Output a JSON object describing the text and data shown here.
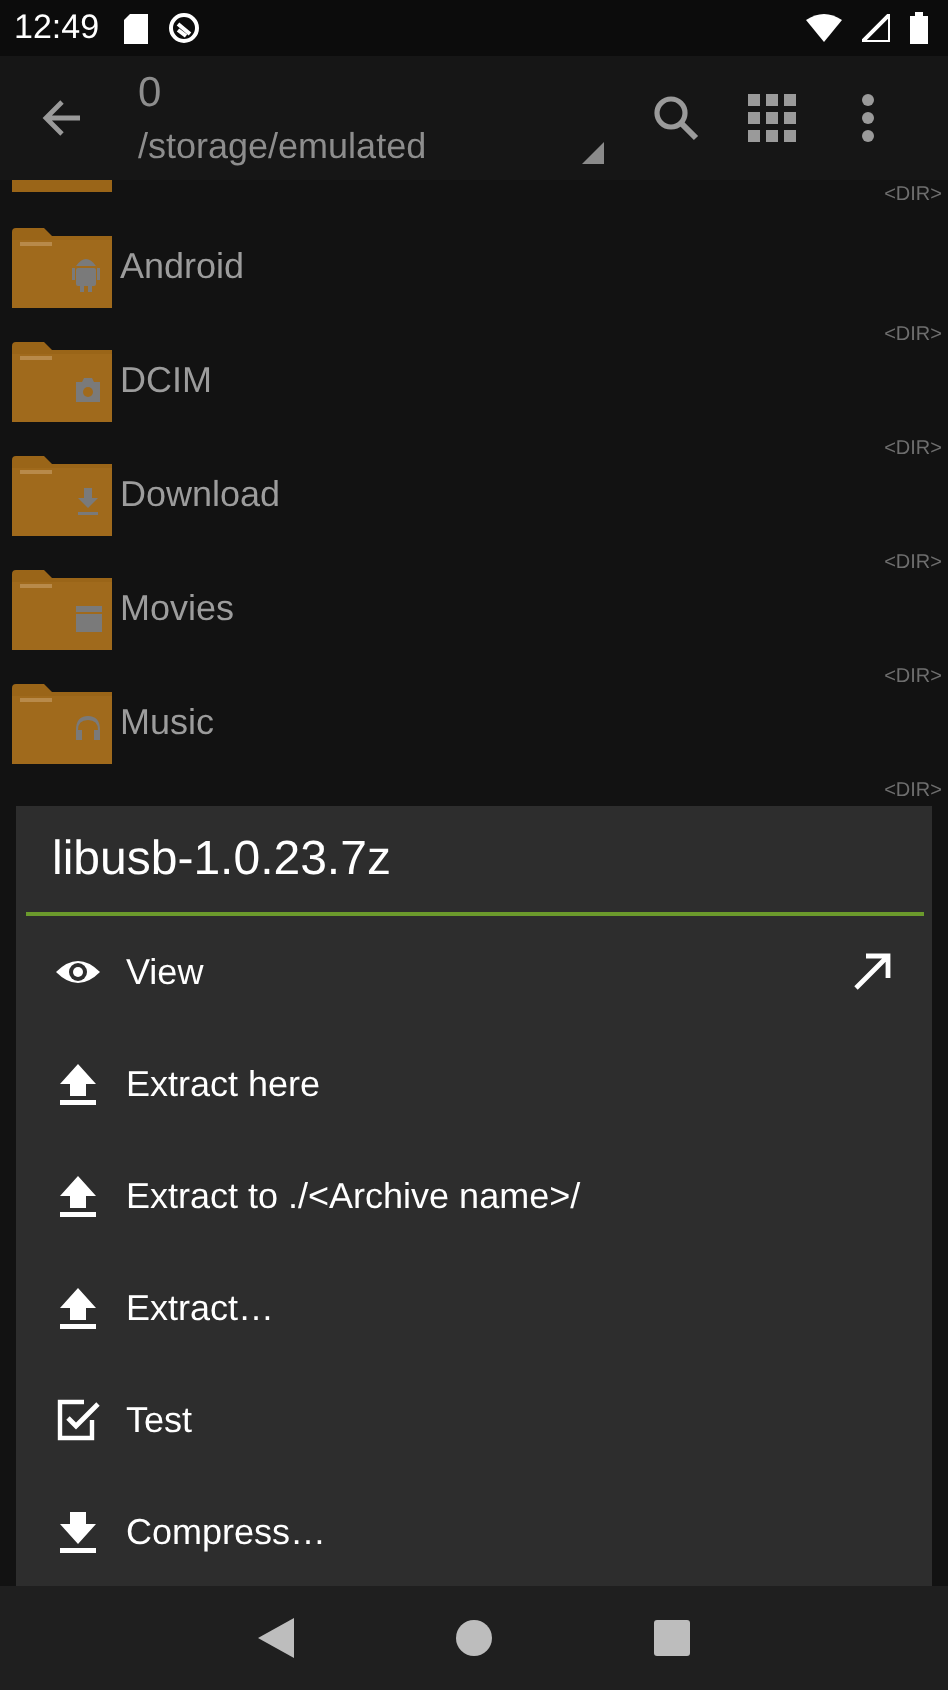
{
  "status_bar": {
    "time": "12:49"
  },
  "app_bar": {
    "title": "0",
    "path": "/storage/emulated"
  },
  "files": [
    {
      "dir": "<DIR>"
    },
    {
      "name": "Android",
      "kind": "android",
      "dir": "<DIR>"
    },
    {
      "name": "DCIM",
      "kind": "camera",
      "dir": "<DIR>"
    },
    {
      "name": "Download",
      "kind": "download",
      "dir": "<DIR>"
    },
    {
      "name": "Movies",
      "kind": "movie",
      "dir": "<DIR>"
    },
    {
      "name": "Music",
      "kind": "music",
      "dir": "<DIR>"
    }
  ],
  "dialog": {
    "title": "libusb-1.0.23.7z",
    "items": [
      {
        "label": "View",
        "kind": "view",
        "shortcut": true
      },
      {
        "label": "Extract here",
        "kind": "extract",
        "shortcut": false
      },
      {
        "label": "Extract to ./<Archive name>/",
        "kind": "extract",
        "shortcut": false
      },
      {
        "label": "Extract…",
        "kind": "extract",
        "shortcut": false
      },
      {
        "label": "Test",
        "kind": "test",
        "shortcut": false
      },
      {
        "label": "Compress…",
        "kind": "compress",
        "shortcut": false
      }
    ]
  }
}
